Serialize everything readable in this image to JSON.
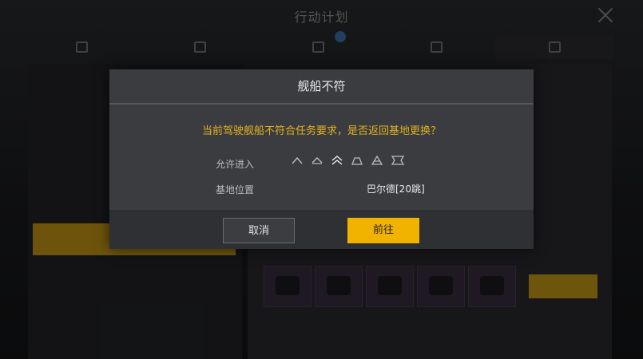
{
  "window": {
    "title": "行动计划"
  },
  "dialog": {
    "title": "舰船不符",
    "message": "当前驾驶舰船不符合任务要求，是否返回基地更换？",
    "allowed_label": "允许进入",
    "allowed_icons": [
      "ship-class-1-icon",
      "ship-class-2-icon",
      "ship-class-3-icon",
      "ship-class-4-icon",
      "ship-class-5-icon",
      "ship-class-6-icon"
    ],
    "base_label": "基地位置",
    "base_value": "巴尔德[20跳]",
    "cancel_label": "取消",
    "go_label": "前往"
  },
  "colors": {
    "accent": "#f1b300",
    "message": "#e2b21f"
  }
}
